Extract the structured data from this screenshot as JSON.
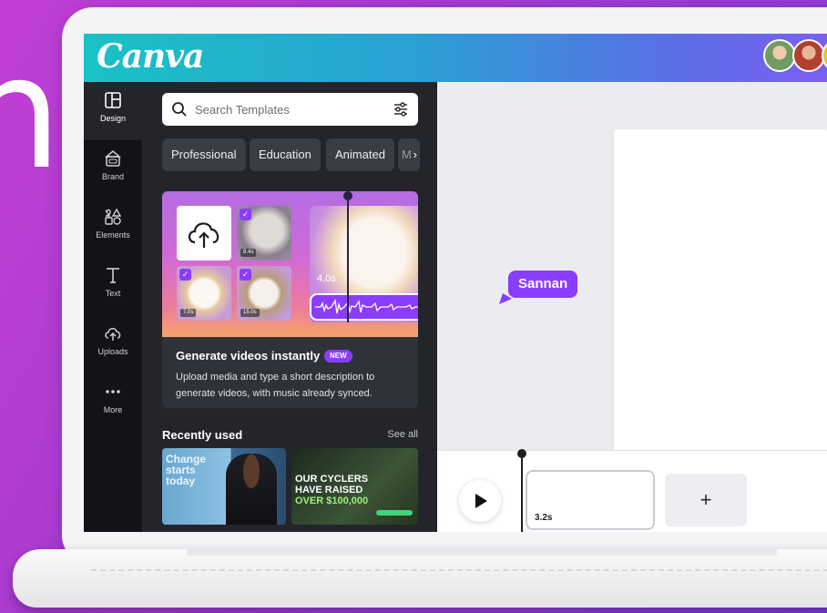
{
  "background": {
    "partial_text": "n",
    "accent": "#b13fd3"
  },
  "app": {
    "logo": "Canva",
    "brand_color": "#8b3dff"
  },
  "collaborators": [
    {
      "name": "collaborator-1"
    },
    {
      "name": "collaborator-2"
    },
    {
      "name": "collaborator-3"
    }
  ],
  "rail": {
    "items": [
      {
        "label": "Design",
        "icon": "layout-icon",
        "active": true
      },
      {
        "label": "Brand",
        "icon": "brand-kit-icon"
      },
      {
        "label": "Elements",
        "icon": "shapes-icon"
      },
      {
        "label": "Text",
        "icon": "text-icon"
      },
      {
        "label": "Uploads",
        "icon": "cloud-upload-icon"
      },
      {
        "label": "More",
        "icon": "more-dots-icon"
      }
    ]
  },
  "search": {
    "placeholder": "Search Templates"
  },
  "chips": [
    "Professional",
    "Education",
    "Animated",
    "M"
  ],
  "feature": {
    "title": "Generate videos instantly",
    "badge": "NEW",
    "description": "Upload media and type a short description to generate videos, with music already synced.",
    "clip_durations": [
      "8.4s",
      "7.0s",
      "15.0s"
    ],
    "preview_duration": "4.0s"
  },
  "recently_used": {
    "title": "Recently used",
    "see_all": "See all",
    "items": [
      {
        "text": "Change starts today"
      },
      {
        "text_line1": "OUR CYCLERS",
        "text_line2": "HAVE RAISED",
        "text_line3": "OVER $100,000"
      }
    ]
  },
  "canvas": {
    "cursor_name": "Sannan"
  },
  "timeline": {
    "clip_duration": "3.2s",
    "add_label": "+"
  }
}
